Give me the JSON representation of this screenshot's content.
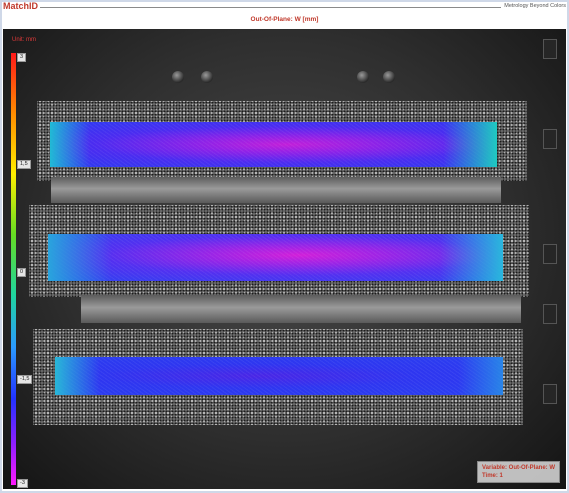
{
  "header": {
    "brand": "MatchID",
    "tagline": "Metrology Beyond Colors"
  },
  "plot": {
    "title": "Out-Of-Plane: W [mm]",
    "unit_label": "Unit: mm",
    "colorbar": {
      "ticks": [
        "3",
        "1,5",
        "0",
        "-1,5",
        "-3"
      ]
    },
    "info": {
      "variable": "Variable: Out-Of-Plane: W",
      "time": "Time: 1"
    }
  },
  "colors": {
    "brand_red": "#c0392b",
    "strip_blue": "#2a3cf0",
    "strip_magenta": "#c21fd9",
    "strip_cyan": "#2ab8d8"
  }
}
